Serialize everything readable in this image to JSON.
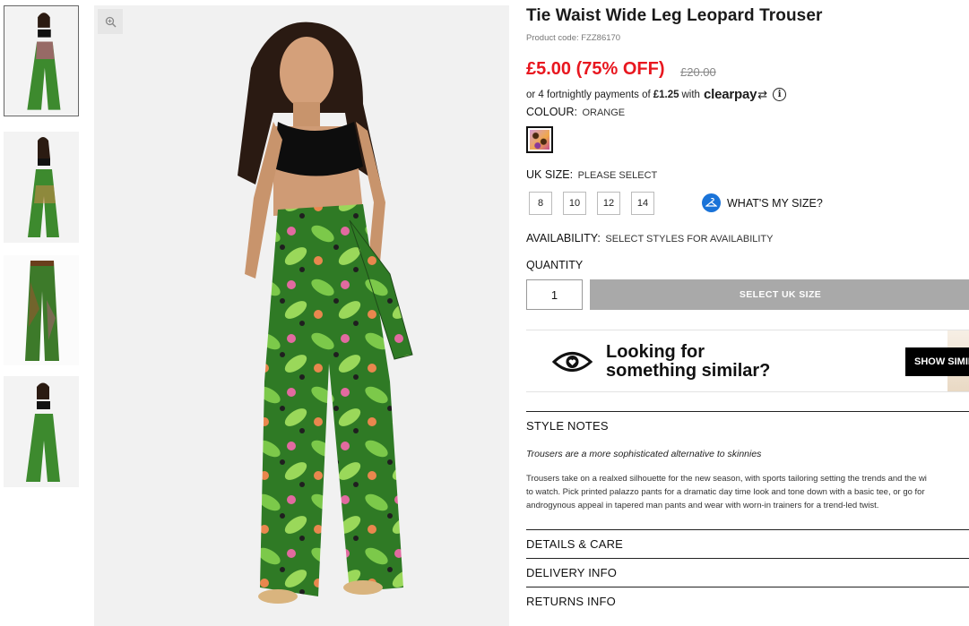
{
  "product": {
    "title": "Tie Waist Wide Leg Leopard Trouser",
    "code": "Product code: FZZ86170",
    "price": "£5.00 (75% OFF)",
    "old_price": "£20.00"
  },
  "clearpay": {
    "prefix": "or 4 fortnightly payments of",
    "amount": "£1.25",
    "with": "with",
    "brand": "clearpay",
    "info_glyph": "i"
  },
  "colour": {
    "label": "COLOUR:",
    "value": "ORANGE"
  },
  "size": {
    "label": "UK SIZE:",
    "value": "PLEASE SELECT",
    "options": [
      "8",
      "10",
      "12",
      "14"
    ],
    "guide": "WHAT'S MY SIZE?"
  },
  "availability": {
    "label": "AVAILABILITY:",
    "value": "SELECT STYLES FOR AVAILABILITY"
  },
  "quantity": {
    "label": "QUANTITY",
    "value": "1"
  },
  "cta": {
    "label": "SELECT UK SIZE"
  },
  "similar": {
    "line1": "Looking for",
    "line2": "something similar?",
    "button": "SHOW SIMILAR"
  },
  "sections": {
    "style_notes": "STYLE NOTES",
    "details": "DETAILS & CARE",
    "delivery": "DELIVERY INFO",
    "returns": "RETURNS INFO"
  },
  "style_notes": {
    "subtitle": "Trousers are a more sophisticated alternative to skinnies",
    "body_lines": [
      "Trousers take on a realxed silhouette for the new season, with sports tailoring setting the trends and the wi",
      "to watch. Pick printed palazzo pants for a dramatic day time look and tone down with a basic tee, or go for",
      "androgynous appeal in tapered man pants and wear with worn-in trainers for a trend-led twist."
    ]
  },
  "icons": {
    "zoom": "zoom-in-icon",
    "hanger": "hanger-icon",
    "eye": "eye-heart-icon",
    "info": "info-icon"
  },
  "colors": {
    "sale_red": "#e8171f",
    "disabled_button": "#a9a9a9",
    "size_guide_blue": "#1a73d8"
  }
}
